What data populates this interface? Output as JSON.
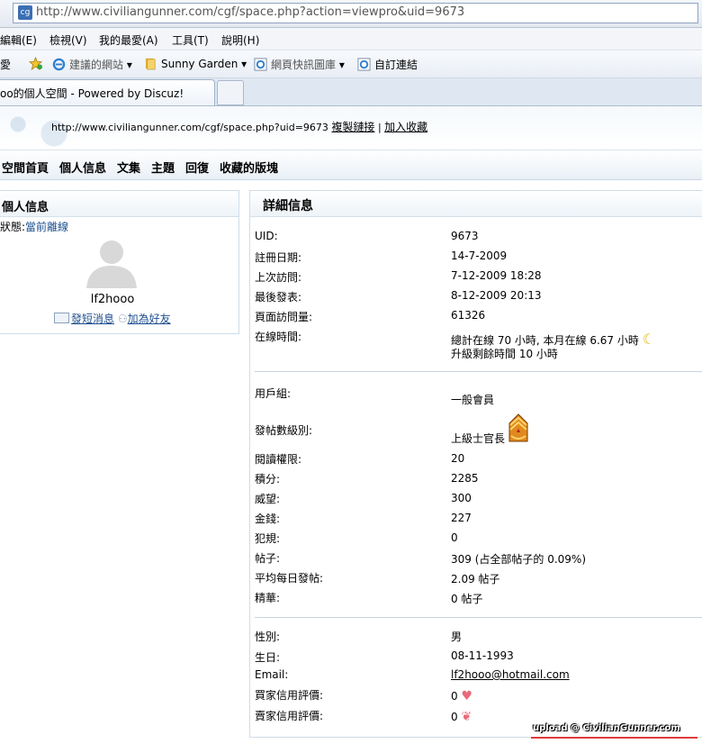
{
  "browser": {
    "url": "http://www.civiliangunner.com/cgf/space.php?action=viewpro&uid=9673",
    "menu": [
      "編輯(E)",
      "檢視(V)",
      "我的最愛(A)",
      "工具(T)",
      "說明(H)"
    ],
    "menu_partial": "愛",
    "favorites": [
      "建議的網站",
      "Sunny Garden",
      "網頁快訊圖庫",
      "自訂連結"
    ],
    "tab_title": "oo的個人空間 - Powered by Discuz!"
  },
  "header": {
    "space_url": "http://www.civiliangunner.com/cgf/space.php?uid=9673",
    "copy_link": "複製鏈接",
    "add_favorite": "加入收藏",
    "separator": "|"
  },
  "nav": [
    "空間首頁",
    "個人信息",
    "文集",
    "主題",
    "回復",
    "收藏的版塊"
  ],
  "left": {
    "title": "個人信息",
    "status_label": "狀態:",
    "status_value": "當前離線",
    "username": "lf2hooo",
    "send_message": "發短消息",
    "add_friend": "加為好友"
  },
  "right": {
    "title": "詳細信息",
    "uid_label": "UID:",
    "uid": "9673",
    "reg_label": "註冊日期:",
    "reg": "14-7-2009",
    "lastvisit_label": "上次訪問:",
    "lastvisit": "7-12-2009 18:28",
    "lastpost_label": "最後發表:",
    "lastpost": "8-12-2009 20:13",
    "views_label": "頁面訪問量:",
    "views": "61326",
    "online_label": "在線時間:",
    "online": "總計在線 70 小時, 本月在線 6.67 小時",
    "online_upgrade": "升級剩餘時間 10 小時",
    "group_label": "用戶組:",
    "group": "一般會員",
    "rank_label": "發帖數級別:",
    "rank": "上級士官長",
    "readperm_label": "閱讀權限:",
    "readperm": "20",
    "credits_label": "積分:",
    "credits": "2285",
    "prestige_label": "威望:",
    "prestige": "300",
    "money_label": "金錢:",
    "money": "227",
    "violation_label": "犯規:",
    "violation": "0",
    "posts_label": "帖子:",
    "posts": "309 (占全部帖子的 0.09%)",
    "avgposts_label": "平均每日發帖:",
    "avgposts": "2.09 帖子",
    "digest_label": "精華:",
    "digest": "0 帖子",
    "gender_label": "性別:",
    "gender": "男",
    "birthday_label": "生日:",
    "birthday": "08-11-1993",
    "email_label": "Email:",
    "email": "lf2hooo@hotmail.com",
    "buyer_label": "買家信用評價:",
    "buyer": "0",
    "seller_label": "賣家信用評價:",
    "seller": "0"
  },
  "watermark": "upload @ CivilianGunner.com",
  "colors": {
    "link": "#1e4f8f",
    "panel_border": "#cfdde9",
    "watermark_line": "#e23a3a"
  }
}
